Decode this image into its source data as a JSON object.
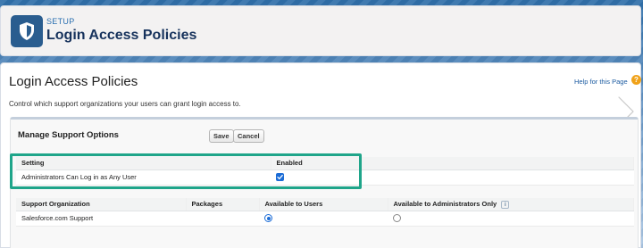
{
  "header": {
    "breadcrumb": "SETUP",
    "title": "Login Access Policies",
    "icon": "shield-icon"
  },
  "page": {
    "title": "Login Access Policies",
    "help_link": "Help for this Page",
    "help_icon": "?",
    "description": "Control which support organizations your users can grant login access to."
  },
  "section": {
    "title": "Manage Support Options",
    "save_label": "Save",
    "cancel_label": "Cancel"
  },
  "settings_table": {
    "columns": [
      "Setting",
      "Enabled"
    ],
    "rows": [
      {
        "setting": "Administrators Can Log in as Any User",
        "enabled": true
      }
    ]
  },
  "support_table": {
    "columns": [
      "Support Organization",
      "Packages",
      "Available to Users",
      "Available to Administrators Only"
    ],
    "info_icon": "i",
    "rows": [
      {
        "organization": "Salesforce.com Support",
        "packages": "",
        "available_to_users": true,
        "available_to_admins_only": false
      }
    ]
  },
  "colors": {
    "accent": "#1b6cd6",
    "highlight": "#1fa58a",
    "help": "#f0a21a"
  }
}
